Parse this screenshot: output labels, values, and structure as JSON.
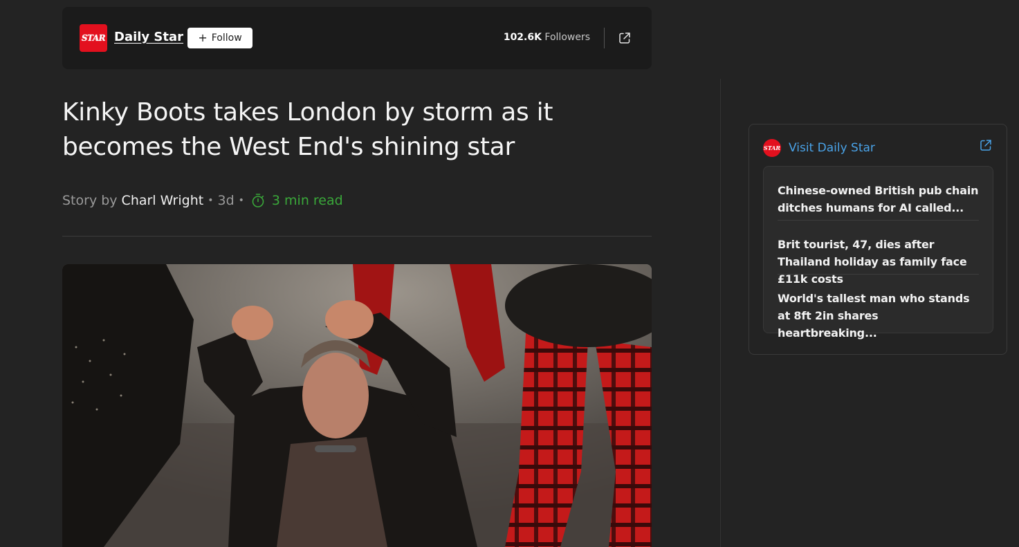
{
  "publisher": {
    "logo_text": "STAR",
    "name": "Daily Star",
    "follow_label": "Follow",
    "followers_count": "102.6K",
    "followers_label": "Followers"
  },
  "article": {
    "headline": "Kinky Boots takes London by storm as it becomes the West End's shining star",
    "story_by": "Story by",
    "author": "Charl Wright",
    "age": "3d",
    "read_time": "3 min read"
  },
  "sidebar": {
    "logo_text": "STAR",
    "visit_label": "Visit Daily Star",
    "stories": [
      {
        "title": "Chinese-owned British pub chain ditches humans for AI called..."
      },
      {
        "title": "Brit tourist, 47, dies after Thailand holiday as family face £11k costs"
      },
      {
        "title": "World's tallest man who stands at 8ft 2in shares heartbreaking..."
      }
    ]
  },
  "colors": {
    "background": "#232323",
    "brand_red": "#e3101e",
    "link_blue": "#4aa3e8",
    "read_time_green": "#3aa83a"
  },
  "icons": {
    "external_link": "external-link-icon",
    "timer": "stopwatch-icon",
    "plus": "plus-icon"
  }
}
